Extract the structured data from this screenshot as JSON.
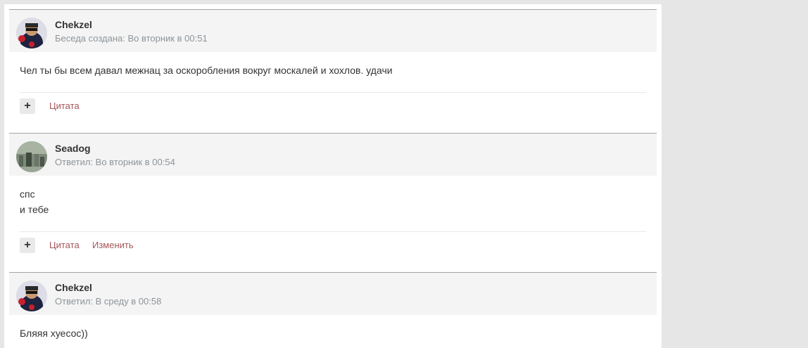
{
  "messages": [
    {
      "author": "Chekzel",
      "meta": "Беседа создана: Во вторник в 00:51",
      "avatar_icon": "user-avatar-icon",
      "lines": [
        "Чел ты бы всем давал межнац за оскоробления вокруг москалей и хохлов. удачи"
      ],
      "plus_label": "+",
      "quote_label": "Цитата"
    },
    {
      "author": "Seadog",
      "meta": "Ответил: Во вторник в 00:54",
      "avatar_icon": "user-avatar-icon",
      "lines": [
        "спс",
        "и тебе"
      ],
      "plus_label": "+",
      "quote_label": "Цитата",
      "edit_label": "Изменить"
    },
    {
      "author": "Chekzel",
      "meta": "Ответил: В среду в 00:58",
      "avatar_icon": "user-avatar-icon",
      "lines": [
        "Бляяя хуесос))"
      ]
    }
  ],
  "colors": {
    "link": "#a5565a",
    "meta": "#8d949a",
    "header_bg": "#f4f4f4",
    "page_bg": "#e6e6e6"
  }
}
